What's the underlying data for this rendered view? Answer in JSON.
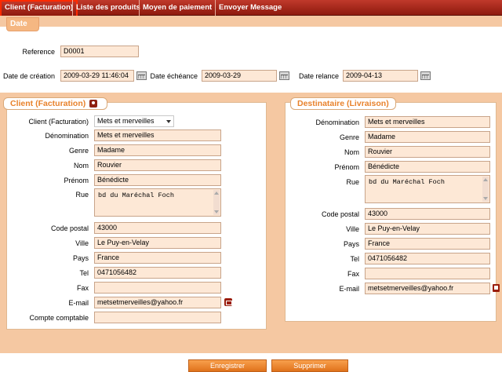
{
  "nav": {
    "tabs": [
      {
        "label": "Client (Facturation)"
      },
      {
        "label": "Liste des produits"
      },
      {
        "label": "Moyen de paiement"
      },
      {
        "label": "Envoyer Message"
      }
    ]
  },
  "date_section": {
    "title": "Date",
    "reference_label": "Reference",
    "reference_value": "D0001",
    "creation_label": "Date de création",
    "creation_value": "2009-03-29 11:46:04",
    "echeance_label": "Date échéance",
    "echeance_value": "2009-03-29",
    "relance_label": "Date relance",
    "relance_value": "2009-04-13"
  },
  "client": {
    "title": "Client (Facturation)",
    "select_label": "Client (Facturation)",
    "select_value": "Mets et merveilles",
    "denomination_label": "Dénomination",
    "denomination_value": "Mets et merveilles",
    "genre_label": "Genre",
    "genre_value": "Madame",
    "nom_label": "Nom",
    "nom_value": "Rouvier",
    "prenom_label": "Prénom",
    "prenom_value": "Bénédicte",
    "rue_label": "Rue",
    "rue_value": "bd du Maréchal Foch",
    "cp_label": "Code postal",
    "cp_value": "43000",
    "ville_label": "Ville",
    "ville_value": "Le Puy-en-Velay",
    "pays_label": "Pays",
    "pays_value": "France",
    "tel_label": "Tel",
    "tel_value": "0471056482",
    "fax_label": "Fax",
    "fax_value": "",
    "email_label": "E-mail",
    "email_value": "metsetmerveilles@yahoo.fr",
    "compte_label": "Compte comptable",
    "compte_value": ""
  },
  "destinataire": {
    "title": "Destinataire (Livraison)",
    "denomination_label": "Dénomination",
    "denomination_value": "Mets et merveilles",
    "genre_label": "Genre",
    "genre_value": "Madame",
    "nom_label": "Nom",
    "nom_value": "Rouvier",
    "prenom_label": "Prénom",
    "prenom_value": "Bénédicte",
    "rue_label": "Rue",
    "rue_value": "bd du Maréchal Foch",
    "cp_label": "Code postal",
    "cp_value": "43000",
    "ville_label": "Ville",
    "ville_value": "Le Puy-en-Velay",
    "pays_label": "Pays",
    "pays_value": "France",
    "tel_label": "Tel",
    "tel_value": "0471056482",
    "fax_label": "Fax",
    "fax_value": "",
    "email_label": "E-mail",
    "email_value": "metsetmerveilles@yahoo.fr"
  },
  "actions": {
    "save_label": "Enregistrer",
    "delete_label": "Supprimer"
  },
  "colors": {
    "nav_bar": "#a32614",
    "accent": "#e8822c",
    "field_bg": "#fde8d6",
    "band": "#f5c8a2"
  }
}
